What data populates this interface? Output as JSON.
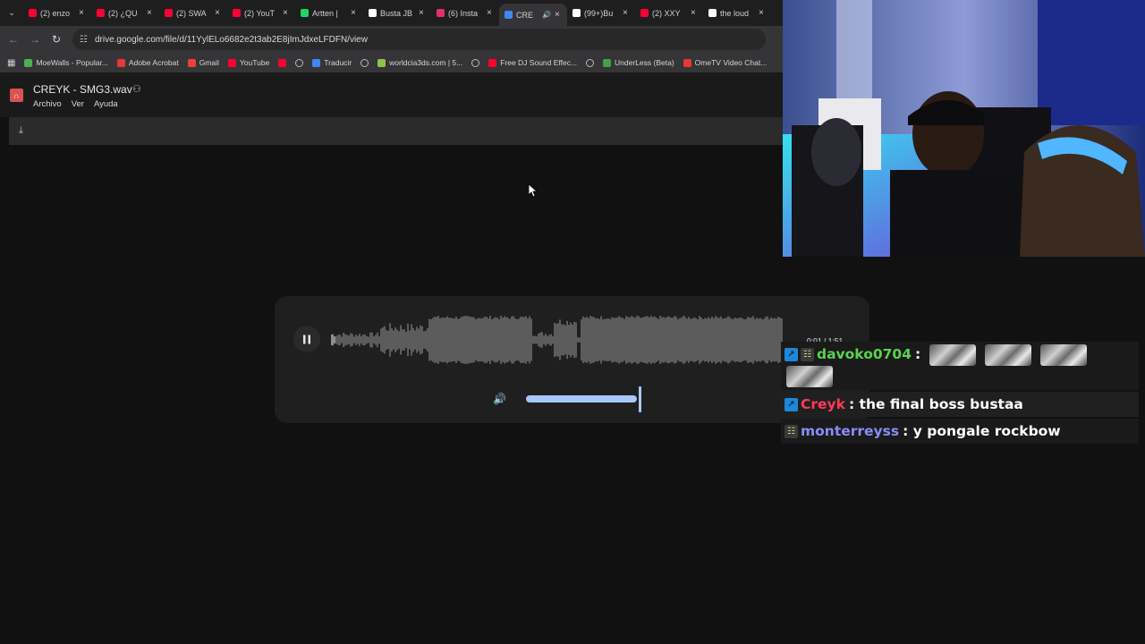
{
  "browser": {
    "tabs": [
      {
        "label": "(2) enzo",
        "icon": "youtube-icon",
        "color": "#ff0033",
        "active": false
      },
      {
        "label": "(2) ¿QU",
        "icon": "youtube-icon",
        "color": "#ff0033",
        "active": false
      },
      {
        "label": "(2) SWA",
        "icon": "youtube-icon",
        "color": "#ff0033",
        "active": false
      },
      {
        "label": "(2) YouT",
        "icon": "youtube-icon",
        "color": "#ff0033",
        "active": false
      },
      {
        "label": "Artten |",
        "icon": "spotify-icon",
        "color": "#1ed760",
        "active": false
      },
      {
        "label": "Busta JB",
        "icon": "tiktok-icon",
        "color": "#ffffff",
        "active": false
      },
      {
        "label": "(6) Insta",
        "icon": "instagram-icon",
        "color": "#e1306c",
        "active": false
      },
      {
        "label": "CRE",
        "icon": "drive-icon",
        "color": "#4285f4",
        "active": true
      },
      {
        "label": "(99+)Bu",
        "icon": "tiktok-icon",
        "color": "#ffffff",
        "active": false
      },
      {
        "label": "(2) XXY",
        "icon": "youtube-icon",
        "color": "#ff0033",
        "active": false
      },
      {
        "label": "the loud",
        "icon": "google-icon",
        "color": "#ffffff",
        "active": false
      }
    ],
    "url": "drive.google.com/file/d/11YylELo6682e2t3ab2E8jImJdxeLFDFN/view",
    "bookmarks": [
      {
        "label": "MoeWalls - Popular...",
        "icon": "moewalls-icon",
        "color": "#4caf50"
      },
      {
        "label": "Adobe Acrobat",
        "icon": "acrobat-icon",
        "color": "#e53935"
      },
      {
        "label": "Gmail",
        "icon": "gmail-icon",
        "color": "#ea4335"
      },
      {
        "label": "YouTube",
        "icon": "youtube-icon",
        "color": "#ff0033"
      },
      {
        "label": "",
        "icon": "youtube-icon",
        "color": "#ff0033"
      },
      {
        "label": "",
        "icon": "globe-icon",
        "color": ""
      },
      {
        "label": "Traducir",
        "icon": "translate-icon",
        "color": "#4285f4"
      },
      {
        "label": "",
        "icon": "globe-icon",
        "color": ""
      },
      {
        "label": "worldcia3ds.com | 5...",
        "icon": "worldcia-icon",
        "color": "#8bc34a"
      },
      {
        "label": "",
        "icon": "globe-icon",
        "color": ""
      },
      {
        "label": "Free DJ Sound Effec...",
        "icon": "youtube-icon",
        "color": "#ff0033"
      },
      {
        "label": "",
        "icon": "globe-icon",
        "color": ""
      },
      {
        "label": "UnderLess (Beta)",
        "icon": "underless-icon",
        "color": "#43a047"
      },
      {
        "label": "OmeTV Video Chat...",
        "icon": "ometv-icon",
        "color": "#e53935"
      }
    ]
  },
  "viewer": {
    "title": "CREYK - SMG3.wav",
    "menu": [
      "Archivo",
      "Ver",
      "Ayuda"
    ]
  },
  "player": {
    "state": "playing",
    "time": "0:01 / 1:51",
    "played_fraction": 0.01,
    "volume": 1.0
  },
  "chat": [
    {
      "user": "davoko0704",
      "user_color": "#59d24f",
      "text": "",
      "badges": [
        "prime-icon",
        "clapper-icon"
      ],
      "emotes": 4
    },
    {
      "user": "Creyk",
      "user_color": "#ff3a55",
      "text": ": the final boss bustaa",
      "badges": [
        "prime-icon"
      ],
      "emotes": 0
    },
    {
      "user": "monterreyss",
      "user_color": "#8a8cf5",
      "text": ": y pongale rockbow",
      "badges": [
        "clapper-icon"
      ],
      "emotes": 0
    }
  ]
}
